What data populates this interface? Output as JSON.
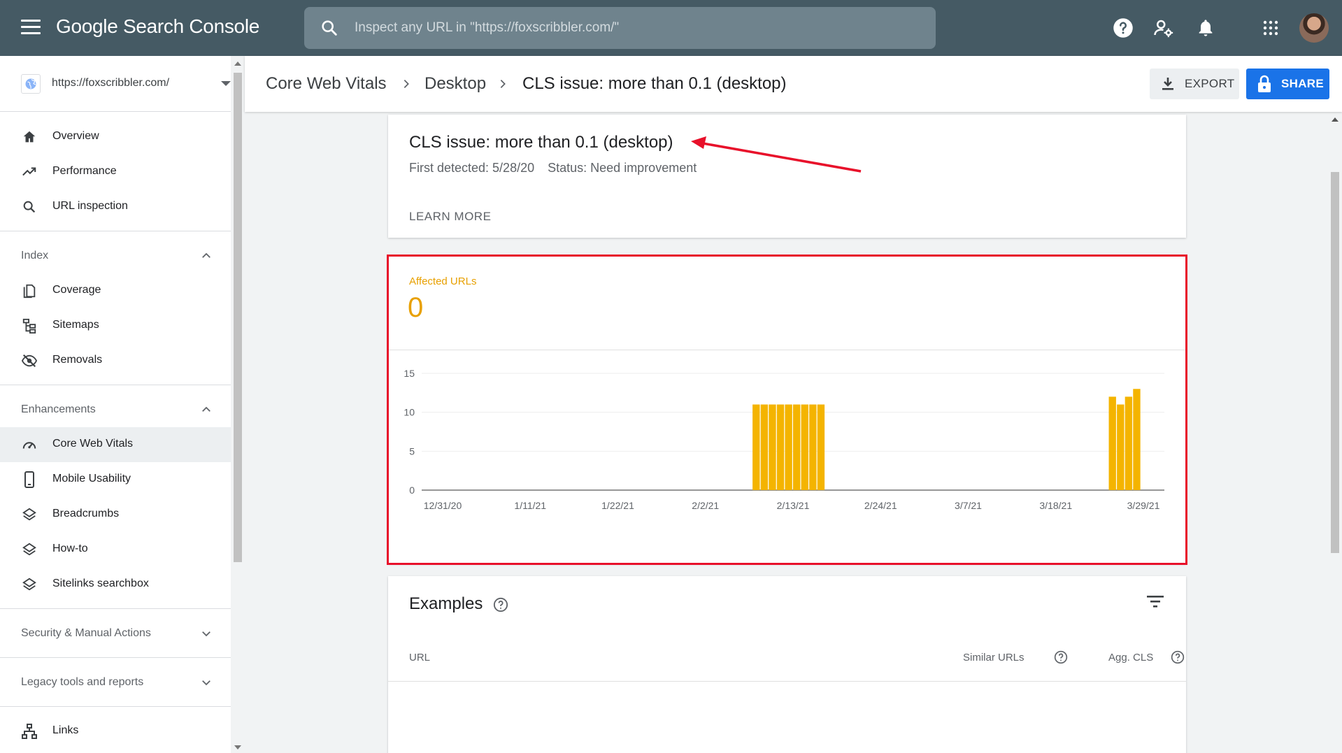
{
  "app": {
    "brand_google": "Google",
    "brand_product": "Search Console"
  },
  "search": {
    "placeholder": "Inspect any URL in \"https://foxscribbler.com/\""
  },
  "property": {
    "label": "https://foxscribbler.com/"
  },
  "sidebar": {
    "top_items": [
      {
        "label": "Overview",
        "icon": "home-icon"
      },
      {
        "label": "Performance",
        "icon": "trending-up-icon"
      },
      {
        "label": "URL inspection",
        "icon": "search-icon"
      }
    ],
    "index_section": "Index",
    "index_items": [
      {
        "label": "Coverage",
        "icon": "coverage-icon"
      },
      {
        "label": "Sitemaps",
        "icon": "sitemap-icon"
      },
      {
        "label": "Removals",
        "icon": "eye-off-icon"
      }
    ],
    "enh_section": "Enhancements",
    "enh_items": [
      {
        "label": "Core Web Vitals",
        "icon": "gauge-icon",
        "active": true
      },
      {
        "label": "Mobile Usability",
        "icon": "phone-icon"
      },
      {
        "label": "Breadcrumbs",
        "icon": "layers-icon"
      },
      {
        "label": "How-to",
        "icon": "layers-icon"
      },
      {
        "label": "Sitelinks searchbox",
        "icon": "layers-icon"
      }
    ],
    "security_section": "Security & Manual Actions",
    "legacy_section": "Legacy tools and reports",
    "links_label": "Links"
  },
  "breadcrumbs": [
    "Core Web Vitals",
    "Desktop",
    "CLS issue: more than 0.1 (desktop)"
  ],
  "actions": {
    "export_label": "EXPORT",
    "share_label": "SHARE"
  },
  "issue": {
    "title": "CLS issue: more than 0.1 (desktop)",
    "first_detected": "First detected: 5/28/20",
    "status": "Status: Need improvement",
    "learn_more": "LEARN MORE"
  },
  "summary": {
    "affected_label": "Affected URLs",
    "affected_value": "0"
  },
  "chart_data": {
    "type": "bar",
    "color": "#f4b400",
    "ylim": [
      0,
      15
    ],
    "yticks": [
      0,
      5,
      10,
      15
    ],
    "x_tick_labels": [
      "12/31/20",
      "1/11/21",
      "1/22/21",
      "2/2/21",
      "2/13/21",
      "2/24/21",
      "3/7/21",
      "3/18/21",
      "3/29/21"
    ],
    "x_start": "12/31/20",
    "x_end": "3/30/21",
    "values": [
      0,
      0,
      0,
      0,
      0,
      0,
      0,
      0,
      0,
      0,
      0,
      0,
      0,
      0,
      0,
      0,
      0,
      0,
      0,
      0,
      0,
      0,
      0,
      0,
      0,
      0,
      0,
      0,
      0,
      0,
      0,
      0,
      0,
      0,
      0,
      0,
      0,
      0,
      0,
      0,
      11,
      11,
      11,
      11,
      11,
      11,
      11,
      11,
      11,
      0,
      0,
      0,
      0,
      0,
      0,
      0,
      0,
      0,
      0,
      0,
      0,
      0,
      0,
      0,
      0,
      0,
      0,
      0,
      0,
      0,
      0,
      0,
      0,
      0,
      0,
      0,
      0,
      0,
      0,
      0,
      0,
      0,
      0,
      0,
      12,
      11,
      12,
      13,
      0,
      0
    ]
  },
  "examples": {
    "title": "Examples",
    "col_url": "URL",
    "col_similar": "Similar URLs",
    "col_agg": "Agg. CLS"
  },
  "colors": {
    "topbar": "#455a64",
    "accent_blue": "#1a73e8",
    "chart_orange": "#e8a000",
    "highlight_red": "#e8102a"
  }
}
